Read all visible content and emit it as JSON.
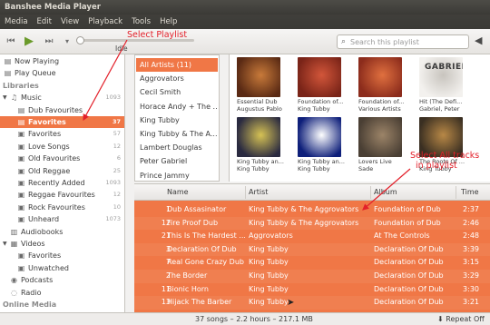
{
  "window": {
    "title": "Banshee Media Player"
  },
  "menu": [
    "Media",
    "Edit",
    "View",
    "Playback",
    "Tools",
    "Help"
  ],
  "toolbar": {
    "status": "Idle",
    "search_placeholder": "Search this playlist"
  },
  "sidebar": [
    {
      "label": "Now Playing",
      "icon": "now-playing-icon",
      "indent": 0,
      "count": ""
    },
    {
      "label": "Play Queue",
      "icon": "play-queue-icon",
      "indent": 0,
      "count": ""
    },
    {
      "label": "Libraries",
      "icon": "",
      "indent": 0,
      "count": "",
      "header": true
    },
    {
      "label": "Music",
      "icon": "music-note-icon",
      "indent": 1,
      "count": "1093",
      "expander": true
    },
    {
      "label": "Dub Favourites",
      "icon": "playlist-icon",
      "indent": 2,
      "count": ""
    },
    {
      "label": "Favorites",
      "icon": "playlist-icon",
      "indent": 2,
      "count": "37",
      "selected": true
    },
    {
      "label": "Favorites",
      "icon": "smart-playlist-icon",
      "indent": 2,
      "count": "57"
    },
    {
      "label": "Love Songs",
      "icon": "smart-playlist-icon",
      "indent": 2,
      "count": "12"
    },
    {
      "label": "Old Favourites",
      "icon": "smart-playlist-icon",
      "indent": 2,
      "count": "6"
    },
    {
      "label": "Old Reggae",
      "icon": "smart-playlist-icon",
      "indent": 2,
      "count": "25"
    },
    {
      "label": "Recently Added",
      "icon": "smart-playlist-icon",
      "indent": 2,
      "count": "1093"
    },
    {
      "label": "Reggae Favourites",
      "icon": "smart-playlist-icon",
      "indent": 2,
      "count": "12"
    },
    {
      "label": "Rock Favourites",
      "icon": "smart-playlist-icon",
      "indent": 2,
      "count": "10"
    },
    {
      "label": "Unheard",
      "icon": "smart-playlist-icon",
      "indent": 2,
      "count": "1073"
    },
    {
      "label": "Audiobooks",
      "icon": "audiobook-icon",
      "indent": 1,
      "count": ""
    },
    {
      "label": "Videos",
      "icon": "video-icon",
      "indent": 1,
      "count": "",
      "expander": true
    },
    {
      "label": "Favorites",
      "icon": "smart-playlist-icon",
      "indent": 2,
      "count": ""
    },
    {
      "label": "Unwatched",
      "icon": "smart-playlist-icon",
      "indent": 2,
      "count": ""
    },
    {
      "label": "Podcasts",
      "icon": "podcast-icon",
      "indent": 1,
      "count": ""
    },
    {
      "label": "Radio",
      "icon": "radio-icon",
      "indent": 1,
      "count": ""
    },
    {
      "label": "Online Media",
      "icon": "",
      "indent": 0,
      "count": "",
      "header": true
    }
  ],
  "artists": [
    {
      "label": "All Artists (11)",
      "selected": true
    },
    {
      "label": "Aggrovators"
    },
    {
      "label": "Cecil Smith"
    },
    {
      "label": "Horace Andy + The ..."
    },
    {
      "label": "King Tubby"
    },
    {
      "label": "King Tubby & The A..."
    },
    {
      "label": "Lambert Douglas"
    },
    {
      "label": "Peter Gabriel"
    },
    {
      "label": "Prince Jammy"
    }
  ],
  "albums": [
    {
      "title": "Essential Dub",
      "artist": "Augustus Pablo",
      "colors": [
        "#5a2a14",
        "#c87a3a"
      ]
    },
    {
      "title": "Foundation of...",
      "artist": "King Tubby",
      "colors": [
        "#7a2418",
        "#d2563a"
      ]
    },
    {
      "title": "Foundation of...",
      "artist": "Various Artists",
      "colors": [
        "#8c2c1c",
        "#e0703f"
      ]
    },
    {
      "title": "Hit (The Defi...",
      "artist": "Gabriel, Peter",
      "colors": [
        "#f3f1ee",
        "#c8c4be"
      ],
      "cover_text": "GABRIEL"
    },
    {
      "title": "King Tubby an...",
      "artist": "King Tubby",
      "colors": [
        "#2a2a40",
        "#d6c254"
      ]
    },
    {
      "title": "King Tubby an...",
      "artist": "King Tubby",
      "colors": [
        "#0e1f7a",
        "#ffffff"
      ]
    },
    {
      "title": "Lovers Live",
      "artist": "Sade",
      "colors": [
        "#4a3f34",
        "#9c8468"
      ]
    },
    {
      "title": "The Roots Of ...",
      "artist": "King Tubby",
      "colors": [
        "#3a2f22",
        "#b88846"
      ]
    }
  ],
  "track_columns": {
    "name": "Name",
    "artist": "Artist",
    "album": "Album",
    "time": "Time"
  },
  "tracks": [
    {
      "num": "1",
      "name": "Dub Assasinator",
      "artist": "King Tubby & The Aggrovators",
      "album": "Foundation of Dub",
      "time": "2:37"
    },
    {
      "num": "12",
      "name": "Fire Proof Dub",
      "artist": "King Tubby & The Aggrovators",
      "album": "Foundation of Dub",
      "time": "2:46"
    },
    {
      "num": "21",
      "name": "This Is The Hardest ...",
      "artist": "Aggrovators",
      "album": "At The Controls",
      "time": "2:48"
    },
    {
      "num": "3",
      "name": "Declaration Of Dub",
      "artist": "King Tubby",
      "album": "Declaration Of Dub",
      "time": "3:39"
    },
    {
      "num": "7",
      "name": "Real Gone Crazy Dub",
      "artist": "King Tubby",
      "album": "Declaration Of Dub",
      "time": "3:15"
    },
    {
      "num": "2",
      "name": "The Border",
      "artist": "King Tubby",
      "album": "Declaration Of Dub",
      "time": "3:29"
    },
    {
      "num": "11",
      "name": "Bionic Horn",
      "artist": "King Tubby",
      "album": "Declaration Of Dub",
      "time": "3:30"
    },
    {
      "num": "13",
      "name": "Hijack The Barber",
      "artist": "King Tubby",
      "album": "Declaration Of Dub",
      "time": "3:21"
    }
  ],
  "status": {
    "summary": "37 songs – 2.2 hours – 217.1 MB",
    "repeat": "Repeat Off"
  },
  "annotations": {
    "select_playlist": "Select Playlist",
    "select_all_1": "Select All tracks",
    "select_all_2": "in playlist"
  }
}
